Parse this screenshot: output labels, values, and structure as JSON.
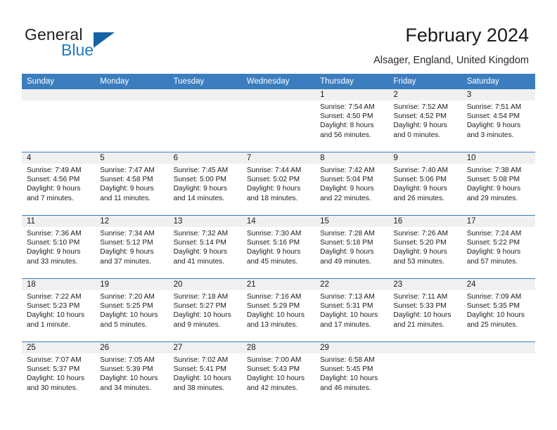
{
  "brand": {
    "name_part1": "General",
    "name_part2": "Blue",
    "flag_icon": "blue-triangle-flag-icon"
  },
  "header": {
    "title": "February 2024",
    "subtitle": "Alsager, England, United Kingdom"
  },
  "calendar": {
    "weekday_headers": [
      "Sunday",
      "Monday",
      "Tuesday",
      "Wednesday",
      "Thursday",
      "Friday",
      "Saturday"
    ],
    "accent_color": "#3b7dbf",
    "daynum_strip_color": "#f0f0f0",
    "weeks": [
      [
        {
          "day": "",
          "empty": true
        },
        {
          "day": "",
          "empty": true
        },
        {
          "day": "",
          "empty": true
        },
        {
          "day": "",
          "empty": true
        },
        {
          "day": "1",
          "sunrise": "Sunrise: 7:54 AM",
          "sunset": "Sunset: 4:50 PM",
          "daylight": "Daylight: 8 hours and 56 minutes."
        },
        {
          "day": "2",
          "sunrise": "Sunrise: 7:52 AM",
          "sunset": "Sunset: 4:52 PM",
          "daylight": "Daylight: 9 hours and 0 minutes."
        },
        {
          "day": "3",
          "sunrise": "Sunrise: 7:51 AM",
          "sunset": "Sunset: 4:54 PM",
          "daylight": "Daylight: 9 hours and 3 minutes."
        }
      ],
      [
        {
          "day": "4",
          "sunrise": "Sunrise: 7:49 AM",
          "sunset": "Sunset: 4:56 PM",
          "daylight": "Daylight: 9 hours and 7 minutes."
        },
        {
          "day": "5",
          "sunrise": "Sunrise: 7:47 AM",
          "sunset": "Sunset: 4:58 PM",
          "daylight": "Daylight: 9 hours and 11 minutes."
        },
        {
          "day": "6",
          "sunrise": "Sunrise: 7:45 AM",
          "sunset": "Sunset: 5:00 PM",
          "daylight": "Daylight: 9 hours and 14 minutes."
        },
        {
          "day": "7",
          "sunrise": "Sunrise: 7:44 AM",
          "sunset": "Sunset: 5:02 PM",
          "daylight": "Daylight: 9 hours and 18 minutes."
        },
        {
          "day": "8",
          "sunrise": "Sunrise: 7:42 AM",
          "sunset": "Sunset: 5:04 PM",
          "daylight": "Daylight: 9 hours and 22 minutes."
        },
        {
          "day": "9",
          "sunrise": "Sunrise: 7:40 AM",
          "sunset": "Sunset: 5:06 PM",
          "daylight": "Daylight: 9 hours and 26 minutes."
        },
        {
          "day": "10",
          "sunrise": "Sunrise: 7:38 AM",
          "sunset": "Sunset: 5:08 PM",
          "daylight": "Daylight: 9 hours and 29 minutes."
        }
      ],
      [
        {
          "day": "11",
          "sunrise": "Sunrise: 7:36 AM",
          "sunset": "Sunset: 5:10 PM",
          "daylight": "Daylight: 9 hours and 33 minutes."
        },
        {
          "day": "12",
          "sunrise": "Sunrise: 7:34 AM",
          "sunset": "Sunset: 5:12 PM",
          "daylight": "Daylight: 9 hours and 37 minutes."
        },
        {
          "day": "13",
          "sunrise": "Sunrise: 7:32 AM",
          "sunset": "Sunset: 5:14 PM",
          "daylight": "Daylight: 9 hours and 41 minutes."
        },
        {
          "day": "14",
          "sunrise": "Sunrise: 7:30 AM",
          "sunset": "Sunset: 5:16 PM",
          "daylight": "Daylight: 9 hours and 45 minutes."
        },
        {
          "day": "15",
          "sunrise": "Sunrise: 7:28 AM",
          "sunset": "Sunset: 5:18 PM",
          "daylight": "Daylight: 9 hours and 49 minutes."
        },
        {
          "day": "16",
          "sunrise": "Sunrise: 7:26 AM",
          "sunset": "Sunset: 5:20 PM",
          "daylight": "Daylight: 9 hours and 53 minutes."
        },
        {
          "day": "17",
          "sunrise": "Sunrise: 7:24 AM",
          "sunset": "Sunset: 5:22 PM",
          "daylight": "Daylight: 9 hours and 57 minutes."
        }
      ],
      [
        {
          "day": "18",
          "sunrise": "Sunrise: 7:22 AM",
          "sunset": "Sunset: 5:23 PM",
          "daylight": "Daylight: 10 hours and 1 minute."
        },
        {
          "day": "19",
          "sunrise": "Sunrise: 7:20 AM",
          "sunset": "Sunset: 5:25 PM",
          "daylight": "Daylight: 10 hours and 5 minutes."
        },
        {
          "day": "20",
          "sunrise": "Sunrise: 7:18 AM",
          "sunset": "Sunset: 5:27 PM",
          "daylight": "Daylight: 10 hours and 9 minutes."
        },
        {
          "day": "21",
          "sunrise": "Sunrise: 7:16 AM",
          "sunset": "Sunset: 5:29 PM",
          "daylight": "Daylight: 10 hours and 13 minutes."
        },
        {
          "day": "22",
          "sunrise": "Sunrise: 7:13 AM",
          "sunset": "Sunset: 5:31 PM",
          "daylight": "Daylight: 10 hours and 17 minutes."
        },
        {
          "day": "23",
          "sunrise": "Sunrise: 7:11 AM",
          "sunset": "Sunset: 5:33 PM",
          "daylight": "Daylight: 10 hours and 21 minutes."
        },
        {
          "day": "24",
          "sunrise": "Sunrise: 7:09 AM",
          "sunset": "Sunset: 5:35 PM",
          "daylight": "Daylight: 10 hours and 25 minutes."
        }
      ],
      [
        {
          "day": "25",
          "sunrise": "Sunrise: 7:07 AM",
          "sunset": "Sunset: 5:37 PM",
          "daylight": "Daylight: 10 hours and 30 minutes."
        },
        {
          "day": "26",
          "sunrise": "Sunrise: 7:05 AM",
          "sunset": "Sunset: 5:39 PM",
          "daylight": "Daylight: 10 hours and 34 minutes."
        },
        {
          "day": "27",
          "sunrise": "Sunrise: 7:02 AM",
          "sunset": "Sunset: 5:41 PM",
          "daylight": "Daylight: 10 hours and 38 minutes."
        },
        {
          "day": "28",
          "sunrise": "Sunrise: 7:00 AM",
          "sunset": "Sunset: 5:43 PM",
          "daylight": "Daylight: 10 hours and 42 minutes."
        },
        {
          "day": "29",
          "sunrise": "Sunrise: 6:58 AM",
          "sunset": "Sunset: 5:45 PM",
          "daylight": "Daylight: 10 hours and 46 minutes."
        },
        {
          "day": "",
          "empty": true
        },
        {
          "day": "",
          "empty": true
        }
      ]
    ]
  }
}
